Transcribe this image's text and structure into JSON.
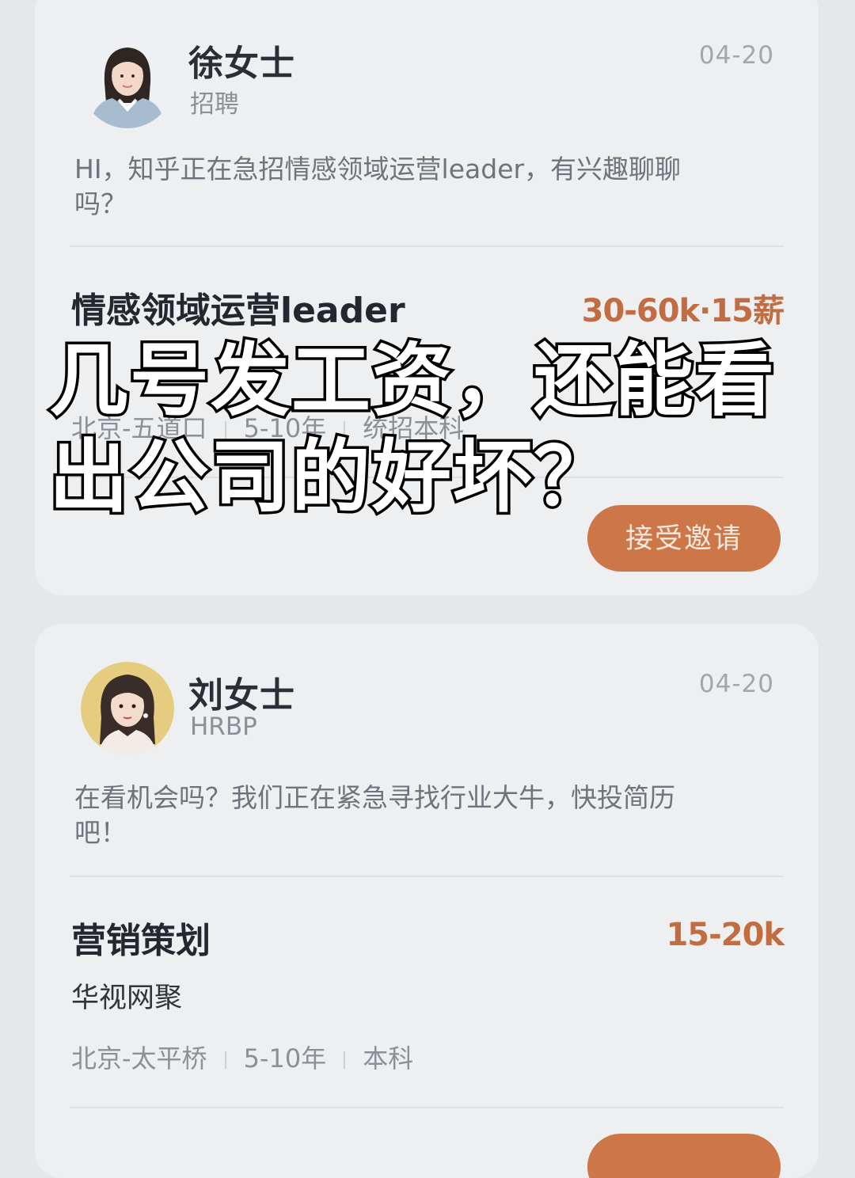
{
  "cards": [
    {
      "recruiter_name": "徐女士",
      "recruiter_role": "招聘",
      "date": "04-20",
      "message": "HI，知乎正在急招情感领域运营leader，有兴趣聊聊吗？",
      "job_title": "情感领域运营leader",
      "salary": "30-60k·15薪",
      "location": "北京-五道口",
      "experience": "5-10年",
      "education": "统招本科",
      "accept_label": "接受邀请"
    },
    {
      "recruiter_name": "刘女士",
      "recruiter_role": "HRBP",
      "date": "04-20",
      "message": "在看机会吗？我们正在紧急寻找行业大牛，快投简历吧！",
      "job_title": "营销策划",
      "salary": "15-20k",
      "company": "华视网聚",
      "location": "北京-太平桥",
      "experience": "5-10年",
      "education": "本科"
    }
  ],
  "overlay": {
    "line1": "几号发工资，还能看",
    "line2": "出公司的好坏？"
  },
  "colors": {
    "accent": "#cd7749",
    "salary": "#c26c42",
    "background": "#e6e7e9",
    "card": "#eeeff1"
  }
}
